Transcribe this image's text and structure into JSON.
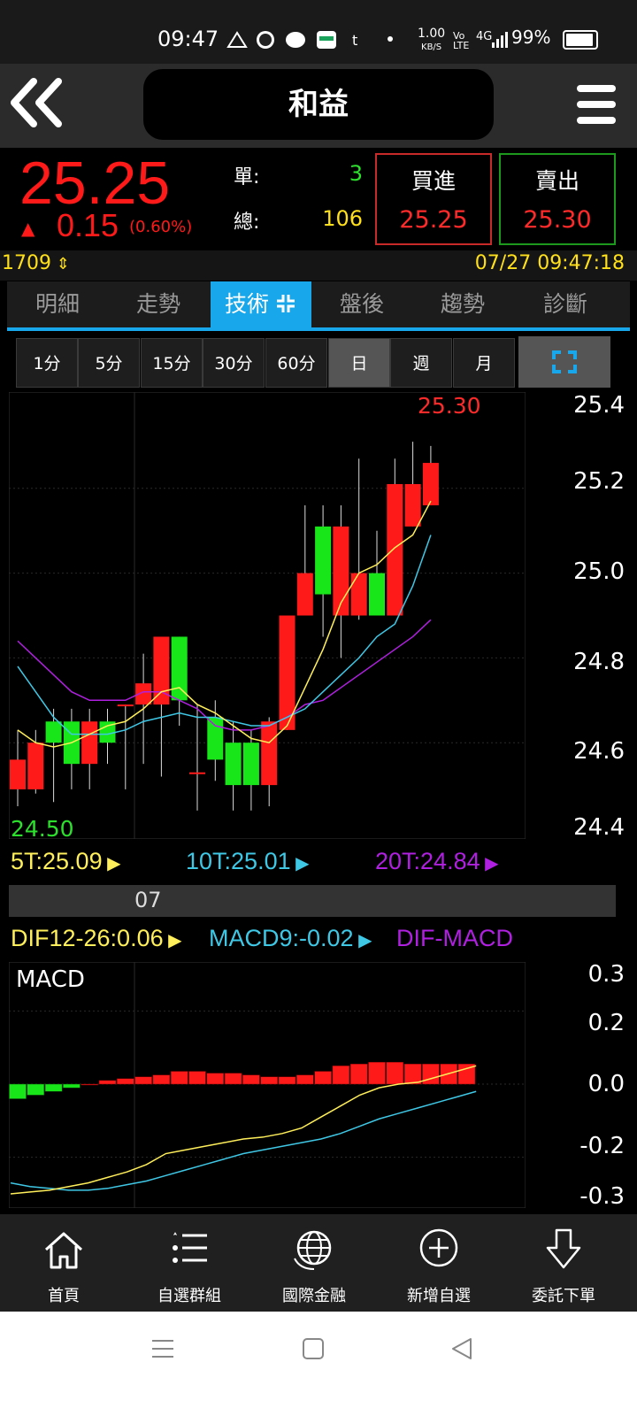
{
  "status_bar": {
    "time": "09:47",
    "icons": [
      "fan-icon",
      "cat-icon",
      "line-icon",
      "wallet-icon",
      "t-icon",
      "dot-icon"
    ],
    "net_speed": "1.00",
    "net_unit": "KB/S",
    "vo_lte": "Vo LTE",
    "signal": "4G",
    "battery": "99%"
  },
  "header": {
    "title": "和益"
  },
  "quote": {
    "price": "25.25",
    "change_arrow": "▲",
    "change": "0.15",
    "change_pct": "(0.60%)",
    "single_label": "單:",
    "single_value": "3",
    "total_label": "總:",
    "total_value": "106",
    "buy_label": "買進",
    "buy_price": "25.25",
    "sell_label": "賣出",
    "sell_price": "25.30",
    "code": "1709",
    "datetime": "07/27 09:47:18"
  },
  "tabs": [
    "明細",
    "走勢",
    "技術",
    "盤後",
    "趨勢",
    "診斷"
  ],
  "active_tab": "技術",
  "periods": [
    "1分",
    "5分",
    "15分",
    "30分",
    "60分",
    "日",
    "週",
    "月"
  ],
  "selected_period": "日",
  "chart": {
    "high_label": "25.30",
    "low_label": "24.50",
    "y_ticks": [
      "25.4",
      "25.2",
      "25.0",
      "24.8",
      "24.6",
      "24.4"
    ],
    "ma5": "5T:25.09",
    "ma10": "10T:25.01",
    "ma20": "20T:24.84",
    "month_label": "07",
    "dif": "DIF12-26:0.06",
    "macd9": "MACD9:-0.02",
    "dif_macd": "DIF-MACD",
    "macd_title": "MACD",
    "macd_y_ticks": [
      "0.3",
      "0.2",
      "0.0",
      "-0.2",
      "-0.3"
    ],
    "colors": {
      "up": "#ff1a1a",
      "down": "#19e619",
      "ma5": "#ffef5a",
      "ma10": "#3fc8e6",
      "ma20": "#b020e0"
    }
  },
  "chart_data": [
    {
      "type": "candlestick",
      "title": "",
      "ylim": [
        24.4,
        25.4
      ],
      "candles": [
        {
          "o": 24.49,
          "h": 24.63,
          "l": 24.45,
          "c": 24.56
        },
        {
          "o": 24.49,
          "h": 24.63,
          "l": 24.48,
          "c": 24.6
        },
        {
          "o": 24.65,
          "h": 24.68,
          "l": 24.46,
          "c": 24.6
        },
        {
          "o": 24.65,
          "h": 24.68,
          "l": 24.49,
          "c": 24.55
        },
        {
          "o": 24.55,
          "h": 24.68,
          "l": 24.49,
          "c": 24.65
        },
        {
          "o": 24.65,
          "h": 24.68,
          "l": 24.55,
          "c": 24.6
        },
        {
          "o": 24.69,
          "h": 24.69,
          "l": 24.49,
          "c": 24.69
        },
        {
          "o": 24.69,
          "h": 24.81,
          "l": 24.55,
          "c": 24.74
        },
        {
          "o": 24.69,
          "h": 24.85,
          "l": 24.52,
          "c": 24.85
        },
        {
          "o": 24.85,
          "h": 24.85,
          "l": 24.64,
          "c": 24.7
        },
        {
          "o": 24.53,
          "h": 24.69,
          "l": 24.44,
          "c": 24.53
        },
        {
          "o": 24.66,
          "h": 24.7,
          "l": 24.51,
          "c": 24.56
        },
        {
          "o": 24.6,
          "h": 24.65,
          "l": 24.44,
          "c": 24.5
        },
        {
          "o": 24.6,
          "h": 24.63,
          "l": 24.44,
          "c": 24.5
        },
        {
          "o": 24.5,
          "h": 24.66,
          "l": 24.45,
          "c": 24.65
        },
        {
          "o": 24.63,
          "h": 24.9,
          "l": 24.63,
          "c": 24.9
        },
        {
          "o": 24.9,
          "h": 25.16,
          "l": 24.9,
          "c": 25.0
        },
        {
          "o": 25.11,
          "h": 25.16,
          "l": 24.85,
          "c": 24.95
        },
        {
          "o": 24.9,
          "h": 25.16,
          "l": 24.8,
          "c": 25.11
        },
        {
          "o": 24.9,
          "h": 25.27,
          "l": 24.89,
          "c": 25.0
        },
        {
          "o": 25.0,
          "h": 25.1,
          "l": 24.9,
          "c": 24.9
        },
        {
          "o": 24.9,
          "h": 25.27,
          "l": 24.9,
          "c": 25.21
        },
        {
          "o": 25.11,
          "h": 25.31,
          "l": 25.11,
          "c": 25.21
        },
        {
          "o": 25.16,
          "h": 25.3,
          "l": 25.16,
          "c": 25.26
        }
      ],
      "ma5": [
        24.63,
        24.6,
        24.59,
        24.6,
        24.62,
        24.64,
        24.65,
        24.68,
        24.72,
        24.73,
        24.69,
        24.67,
        24.64,
        24.61,
        24.6,
        24.64,
        24.73,
        24.82,
        24.93,
        25.0,
        25.02,
        25.06,
        25.09,
        25.17
      ],
      "ma10": [
        24.78,
        24.72,
        24.66,
        24.62,
        24.62,
        24.62,
        24.63,
        24.65,
        24.66,
        24.67,
        24.66,
        24.66,
        24.65,
        24.64,
        24.64,
        24.66,
        24.68,
        24.72,
        24.76,
        24.8,
        24.85,
        24.88,
        24.97,
        25.09
      ],
      "ma20": [
        24.84,
        24.8,
        24.76,
        24.72,
        24.7,
        24.7,
        24.7,
        24.72,
        24.72,
        24.7,
        24.68,
        24.64,
        24.63,
        24.63,
        24.64,
        24.66,
        24.69,
        24.7,
        24.73,
        24.76,
        24.79,
        24.82,
        24.85,
        24.89
      ]
    },
    {
      "type": "bar",
      "title": "MACD",
      "ylim": [
        -0.3,
        0.3
      ],
      "histogram": [
        -0.04,
        -0.03,
        -0.02,
        -0.01,
        0.0,
        0.01,
        0.015,
        0.02,
        0.025,
        0.035,
        0.035,
        0.03,
        0.03,
        0.025,
        0.02,
        0.02,
        0.025,
        0.035,
        0.05,
        0.055,
        0.06,
        0.06,
        0.055,
        0.055,
        0.055,
        0.055
      ],
      "dif": [
        -0.3,
        -0.295,
        -0.29,
        -0.28,
        -0.27,
        -0.255,
        -0.24,
        -0.22,
        -0.19,
        -0.18,
        -0.17,
        -0.16,
        -0.15,
        -0.145,
        -0.135,
        -0.12,
        -0.09,
        -0.06,
        -0.03,
        -0.01,
        0.0,
        0.005,
        0.02,
        0.035,
        0.05
      ],
      "macd": [
        -0.27,
        -0.28,
        -0.285,
        -0.29,
        -0.29,
        -0.285,
        -0.275,
        -0.265,
        -0.25,
        -0.235,
        -0.22,
        -0.205,
        -0.19,
        -0.18,
        -0.17,
        -0.16,
        -0.15,
        -0.135,
        -0.115,
        -0.095,
        -0.08,
        -0.065,
        -0.05,
        -0.035,
        -0.02
      ]
    }
  ],
  "bottom_nav": [
    {
      "label": "首頁",
      "icon": "home-icon"
    },
    {
      "label": "自選群組",
      "icon": "list-icon"
    },
    {
      "label": "國際金融",
      "icon": "globe-icon"
    },
    {
      "label": "新增自選",
      "icon": "add-circle-icon"
    },
    {
      "label": "委託下單",
      "icon": "order-arrow-icon"
    }
  ]
}
